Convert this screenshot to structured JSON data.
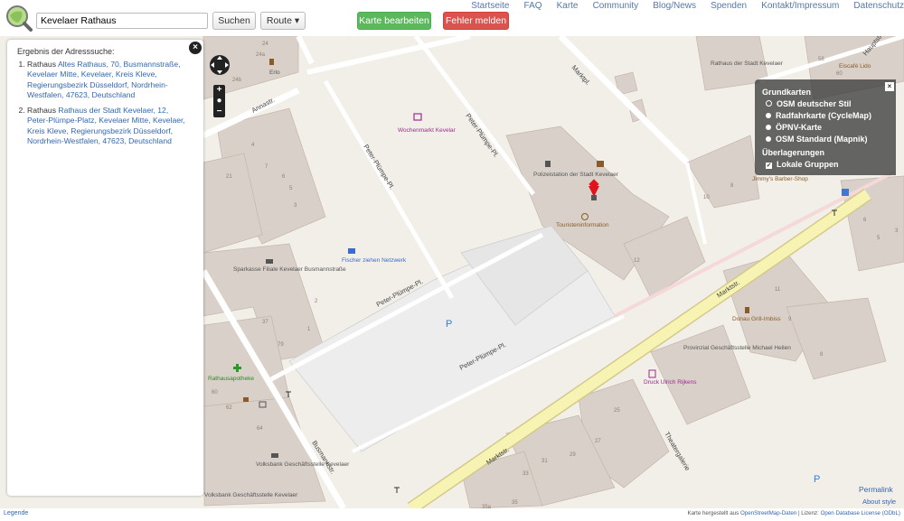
{
  "header": {
    "search_value": "Kevelaer Rathaus",
    "search_button": "Suchen",
    "route_button": "Route ▾",
    "edit_button": "Karte bearbeiten",
    "report_button": "Fehler melden",
    "nav": [
      "Startseite",
      "FAQ",
      "Karte",
      "Community",
      "Blog/News",
      "Spenden",
      "Kontakt/Impressum",
      "Datenschutz"
    ]
  },
  "results": {
    "title": "Ergebnis der Adresssuche:",
    "items": [
      {
        "type": "Rathaus",
        "link": "Altes Rathaus, 70, Busmannstraße, Kevelaer Mitte, Kevelaer, Kreis Kleve, Regierungsbezirk Düsseldorf, Nordrhein-Westfalen, 47623, Deutschland"
      },
      {
        "type": "Rathaus",
        "link": "Rathaus der Stadt Kevelaer, 12, Peter-Plümpe-Platz, Kevelaer Mitte, Kevelaer, Kreis Kleve, Regierungsbezirk Düsseldorf, Nordrhein-Westfalen, 47623, Deutschland"
      }
    ]
  },
  "layers": {
    "base_title": "Grundkarten",
    "base": [
      "OSM deutscher Stil",
      "Radfahrkarte (CycleMap)",
      "ÖPNV-Karte",
      "OSM Standard (Mapnik)"
    ],
    "overlay_title": "Überlagerungen",
    "overlays": [
      "Lokale Gruppen"
    ]
  },
  "map_labels": {
    "streets": [
      "Annastr.",
      "Peter-Plümpe-Pl.",
      "Peter-Plümpe-Pl.",
      "Marktpl.",
      "Peter-Plümpe-Pl.",
      "Peter-Plümpe-Pl.",
      "Busmannstr.",
      "Marktstr.",
      "Marktstr.",
      "Theatergalerie"
    ],
    "pois": [
      "Wochenmarkt Kevelar",
      "Polizeistation der Stadt Kevelaer",
      "Touristeninformation",
      "Fischer ziehen Netzwerk",
      "Sparkasse Filiale Kevelaer Busmannstraße",
      "Rathausapotheke",
      "Volksbank Geschäftsstelle Kevelaer",
      "Volksbank Geschäftsstelle Kevelaer",
      "Rathaus der Stadt Kevelaer",
      "Eiscafé Lido",
      "Jimmy's Barber-Shop",
      "Donau Grill-Imbiss",
      "Provinzial Geschäftsstelle Michael Heilen",
      "Druck Ulrich Rijkens"
    ],
    "house_numbers": [
      "24",
      "24a",
      "24b",
      "21",
      "7",
      "6",
      "5",
      "4",
      "3",
      "2",
      "1",
      "37",
      "79",
      "60",
      "62",
      "64",
      "12",
      "10",
      "8",
      "6",
      "11",
      "9",
      "8",
      "25",
      "27",
      "29",
      "31",
      "33",
      "35",
      "35a",
      "58",
      "60",
      "5",
      "3"
    ],
    "parking": "P",
    "erlo": "Erlo",
    "topright": "Hauptstr."
  },
  "footer": {
    "legend": "Legende",
    "attribution_prefix": "Karte hergestellt aus ",
    "attribution_osm": "OpenStreetMap-Daten",
    "attribution_mid": " | Lizenz: ",
    "attribution_odbl": "Open Database License (ODbL)",
    "permalink": "Permalink",
    "about_style": "About style"
  }
}
